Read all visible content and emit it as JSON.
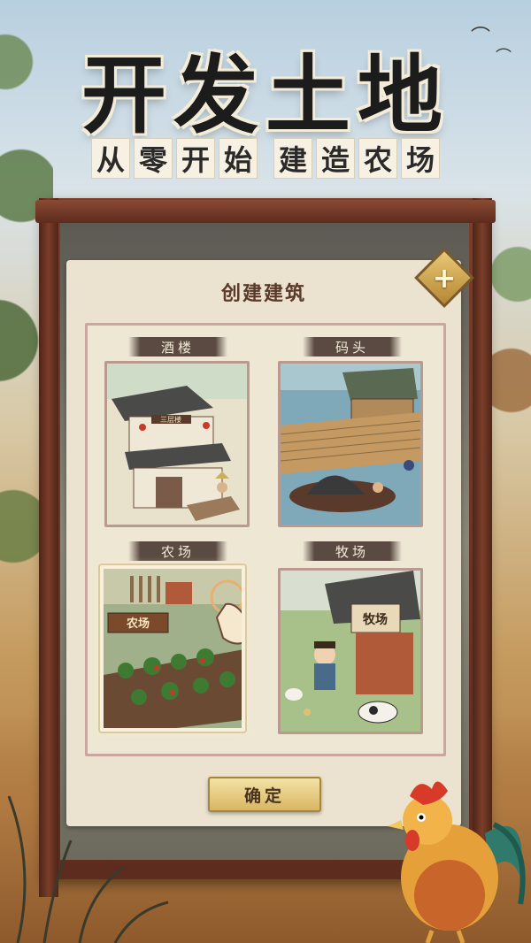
{
  "headline": {
    "title": "开发土地",
    "subtitle_chars": [
      "从",
      "零",
      "开",
      "始",
      "建",
      "造",
      "农",
      "场"
    ]
  },
  "dialog": {
    "title": "创建建筑",
    "close_label": "+",
    "confirm_label": "确定"
  },
  "buildings": [
    {
      "label": "酒楼",
      "sign": "三层楼"
    },
    {
      "label": "码头"
    },
    {
      "label": "农场",
      "sign": "农场",
      "selected": true
    },
    {
      "label": "牧场",
      "sign": "牧场"
    }
  ],
  "colors": {
    "frame": "#6a3222",
    "panel": "#ebe3cf",
    "card_border": "#b89b8e",
    "button_gold": "#d9b662"
  },
  "icons": [
    "close-icon",
    "pointer-hand-icon",
    "rooster-icon",
    "bird-icon"
  ]
}
